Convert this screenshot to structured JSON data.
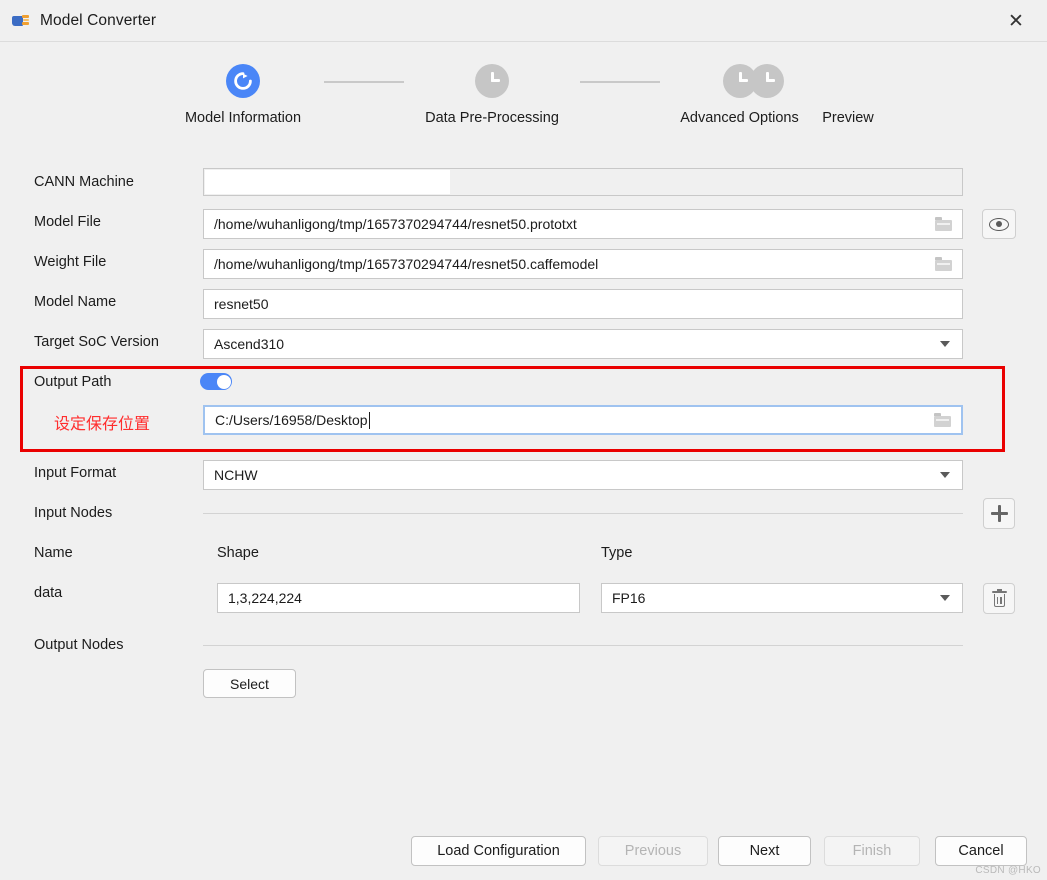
{
  "window": {
    "title": "Model Converter",
    "app_icon": "model-converter-icon",
    "close_icon": "✕"
  },
  "stepper": {
    "steps": [
      {
        "label": "Model Information",
        "state": "active",
        "icon": "spinner-icon"
      },
      {
        "label": "Data Pre-Processing",
        "state": "pending",
        "icon": "clock-icon"
      },
      {
        "label": "Advanced Options",
        "state": "pending",
        "icon": "clock-icon"
      },
      {
        "label": "Preview",
        "state": "pending",
        "icon": "clock-icon"
      }
    ]
  },
  "form": {
    "cann_machine": {
      "label": "CANN Machine",
      "value": "",
      "placeholder": ""
    },
    "model_file": {
      "label": "Model File",
      "value": "/home/wuhanligong/tmp/1657370294744/resnet50.prototxt",
      "browse_icon": "folder-icon",
      "preview_icon": "eye-icon"
    },
    "weight_file": {
      "label": "Weight File",
      "value": "/home/wuhanligong/tmp/1657370294744/resnet50.caffemodel",
      "browse_icon": "folder-icon"
    },
    "model_name": {
      "label": "Model Name",
      "value": "resnet50"
    },
    "target_soc": {
      "label": "Target SoC Version",
      "value": "Ascend310"
    },
    "output_path": {
      "label": "Output Path",
      "toggle_state": "on",
      "value": "C:/Users/16958/Desktop",
      "browse_icon": "folder-icon",
      "annotation": "设定保存位置"
    },
    "input_format": {
      "label": "Input Format",
      "value": "NCHW"
    },
    "input_nodes": {
      "label": "Input Nodes",
      "add_icon": "plus-icon",
      "columns": [
        "Name",
        "Shape",
        "Type"
      ],
      "rows": [
        {
          "name": "data",
          "shape": "1,3,224,224",
          "type": "FP16",
          "delete_icon": "trash-icon"
        }
      ]
    },
    "output_nodes": {
      "label": "Output Nodes",
      "select_label": "Select"
    }
  },
  "footer": {
    "buttons": [
      {
        "label": "Load Configuration",
        "state": "enabled"
      },
      {
        "label": "Previous",
        "state": "disabled"
      },
      {
        "label": "Next",
        "state": "enabled"
      },
      {
        "label": "Finish",
        "state": "disabled"
      },
      {
        "label": "Cancel",
        "state": "enabled"
      }
    ]
  },
  "watermark": "CSDN @HKO",
  "colors": {
    "accent": "#4a86f7",
    "annotation_red": "#ff2d2d",
    "highlight_box": "#ea0000",
    "window_bg": "#f0f0f0",
    "pending_step": "#c6c6c6"
  }
}
